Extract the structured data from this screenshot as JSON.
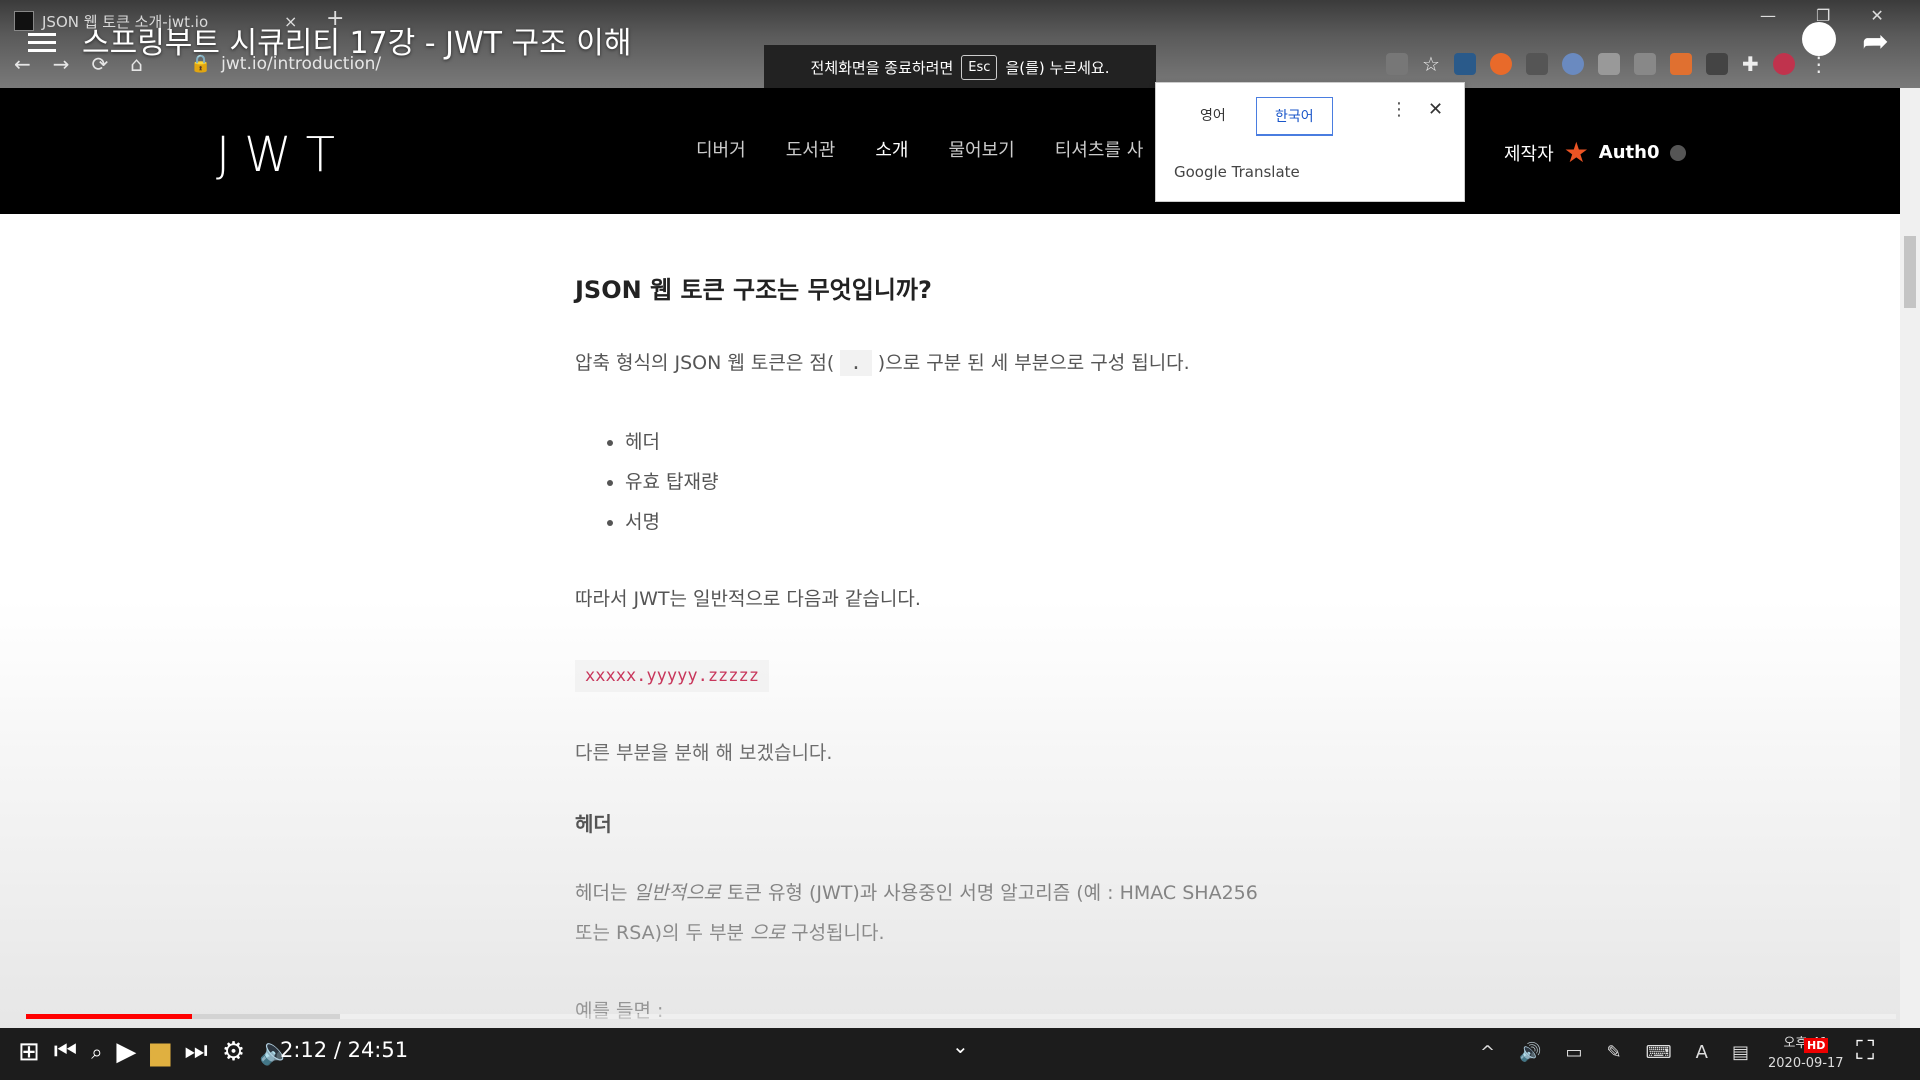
{
  "browser": {
    "tab_title": "JSON 웹 토큰 소개-jwt.io",
    "tab_close": "×",
    "new_tab": "+",
    "url": "jwt.io/introduction/",
    "nav": [
      "←",
      "→",
      "⟳",
      "⌂"
    ],
    "window_controls": [
      "—",
      "❐",
      "✕"
    ]
  },
  "video": {
    "title": "스프링부트 시큐리티 17강 - JWT 구조 이해",
    "time": "2:12 / 24:51",
    "progress": 0.0886,
    "buffered": 0.168,
    "hd_badge": "HD"
  },
  "toast": {
    "before": "전체화면을 종료하려면",
    "key": "Esc",
    "after": "을(를) 누르세요."
  },
  "site": {
    "logo": "JWT",
    "nav": [
      "디버거",
      "도서관",
      "소개",
      "물어보기",
      "티셔츠를 사"
    ],
    "active_nav": "소개",
    "credit_label": "제작자",
    "credit_brand": "Auth0"
  },
  "translate": {
    "source_lang": "영어",
    "target_lang": "한국어",
    "brand": "Google Translate"
  },
  "article": {
    "heading": "JSON 웹 토큰 구조는 무엇입니까?",
    "intro_before": "압축 형식의 JSON 웹 토큰은 점(",
    "intro_dot": ".",
    "intro_after": ")으로 구분 된 세 부분으로 구성 됩니다.",
    "parts": [
      "헤더",
      "유효 탑재량",
      "서명"
    ],
    "typical": "따라서 JWT는 일반적으로 다음과 같습니다.",
    "code": "xxxxx.yyyyy.zzzzz",
    "breakdown": "다른 부분을 분해 해 보겠습니다.",
    "header_title": "헤더",
    "header_p1_before": "헤더는",
    "header_p1_em": "일반적으로",
    "header_p1_after": "토큰 유형 (JWT)과 사용중인 서명 알고리즘 (예 : HMAC SHA256",
    "header_p2_before": "또는 RSA)의 두 부분",
    "header_p2_em": "으로",
    "header_p2_after": "구성됩니다.",
    "example": "예를 들면 :"
  },
  "taskbar": {
    "date": "2020-09-17",
    "time_partial": "오후 41"
  },
  "colors": {
    "site_header": "#000000",
    "progress": "#ff0000",
    "code": "#c7254e",
    "translate_selected": "#1a56c9"
  }
}
